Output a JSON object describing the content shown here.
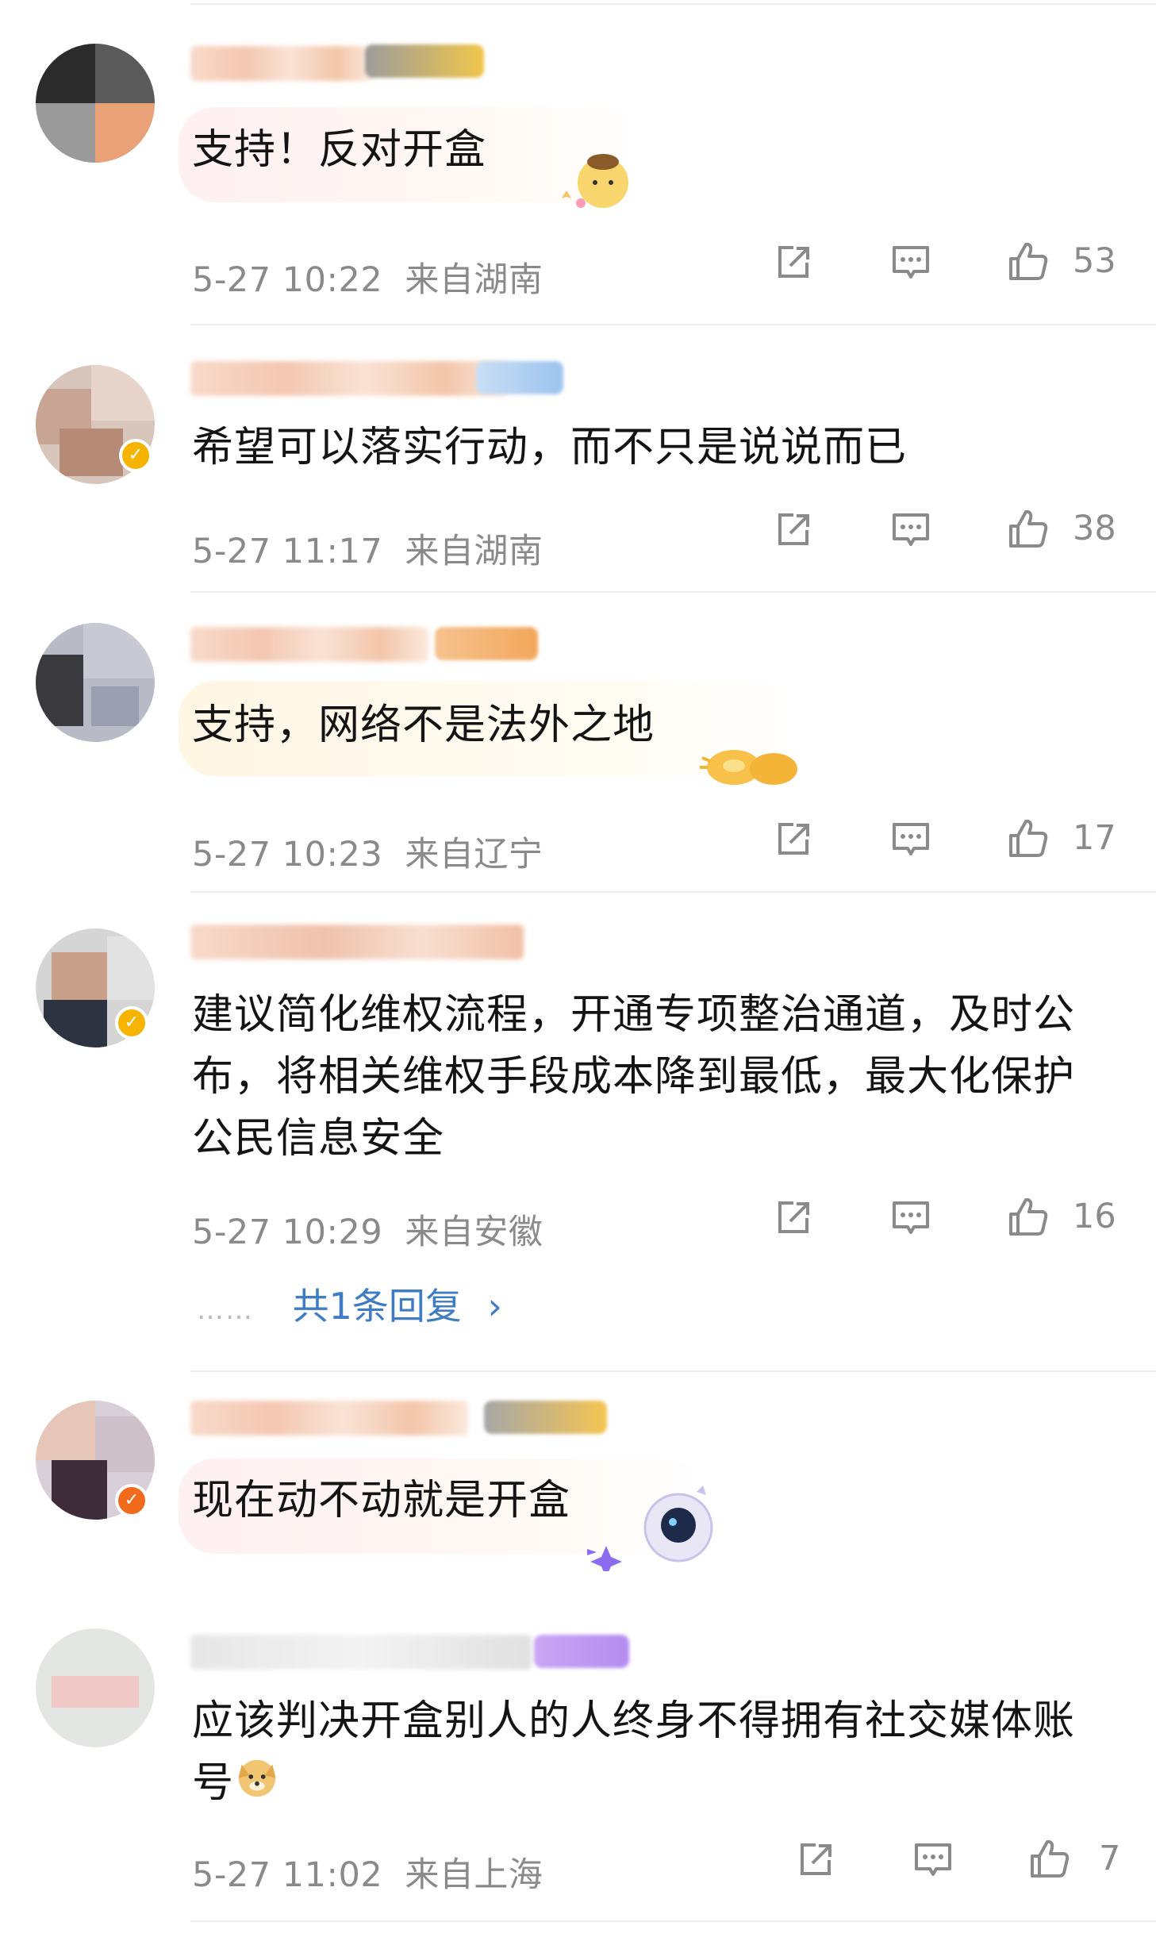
{
  "comments": [
    {
      "text": "支持！反对开盒",
      "time": "5-27 10:22",
      "location": "来自湖南",
      "likes": "53"
    },
    {
      "text": "希望可以落实行动，而不只是说说而已",
      "time": "5-27 11:17",
      "location": "来自湖南",
      "likes": "38"
    },
    {
      "text": "支持，网络不是法外之地",
      "time": "5-27 10:23",
      "location": "来自辽宁",
      "likes": "17"
    },
    {
      "text": "建议简化维权流程，开通专项整治通道，及时公布，将相关维权手段成本降到最低，最大化保护公民信息安全",
      "time": "5-27 10:29",
      "location": "来自安徽",
      "likes": "16",
      "replies": "共1条回复",
      "reply_arrow": "›",
      "reply_dots": "……"
    },
    {
      "text": "现在动不动就是开盒",
      "time": "",
      "location": "",
      "likes": ""
    },
    {
      "text": "应该判决开盒别人的人终身不得拥有社交媒体账号",
      "time": "5-27 11:02",
      "location": "来自上海",
      "likes": "7"
    }
  ],
  "icons": {
    "share": "share-icon",
    "comment": "comment-icon",
    "like": "thumbs-up-icon"
  },
  "colors": {
    "reply_link": "#3f7cc4",
    "meta_text": "#8a8a8a",
    "verified_badge": "#f6b400"
  }
}
